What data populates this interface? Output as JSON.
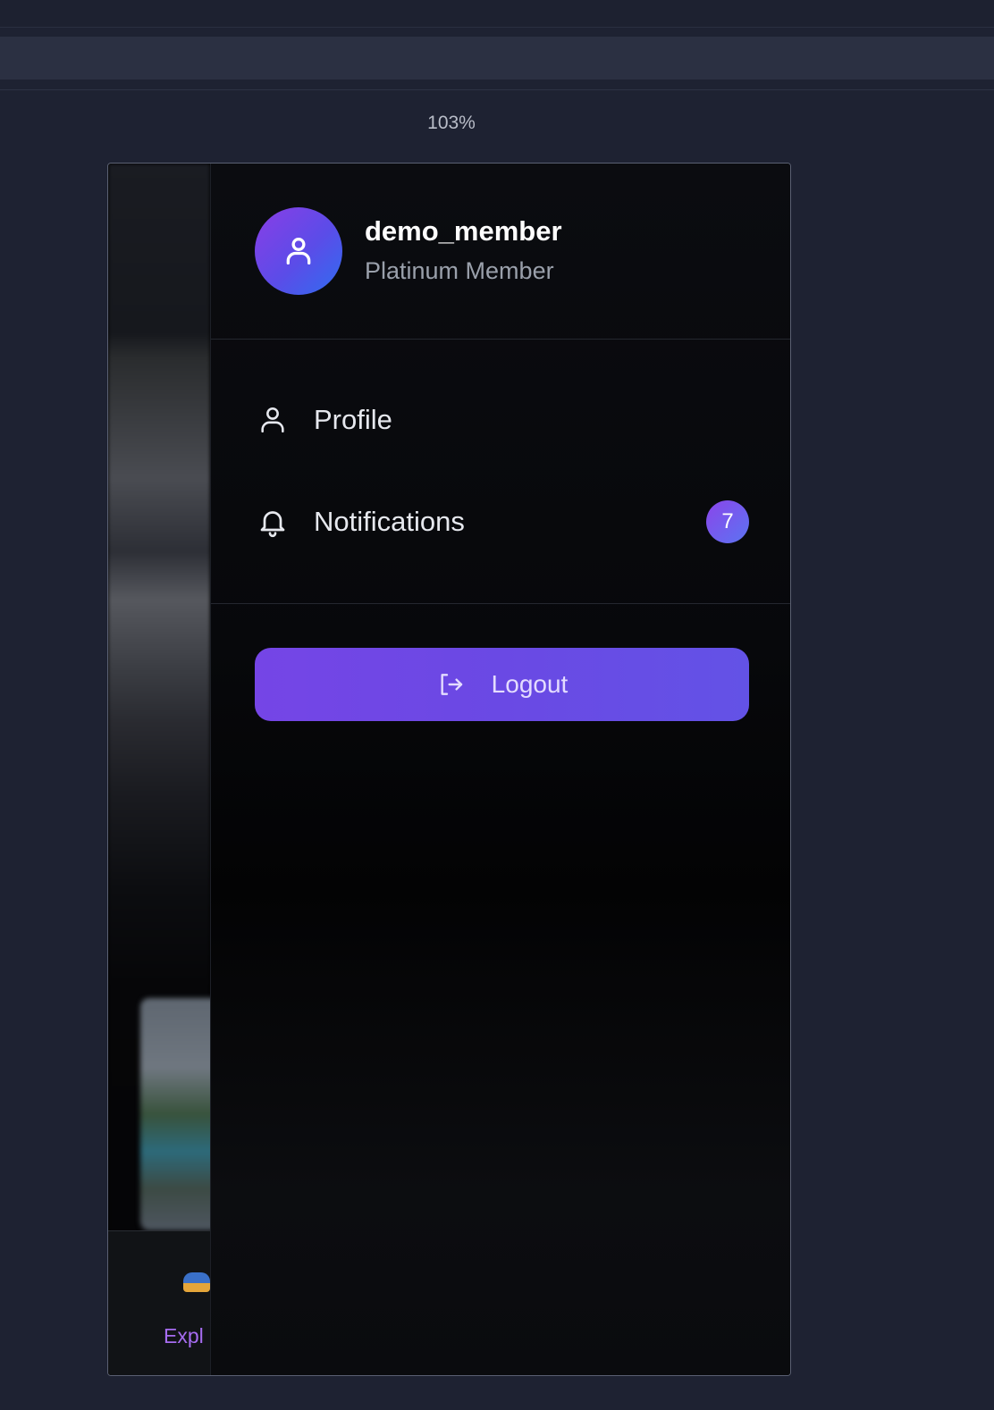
{
  "viewer": {
    "zoom": "103%"
  },
  "background_app": {
    "nav_label": "Expl"
  },
  "drawer": {
    "user": {
      "username": "demo_member",
      "membership": "Platinum Member",
      "avatar_icon": "user-icon"
    },
    "menu": [
      {
        "label": "Profile",
        "icon": "user-icon"
      },
      {
        "label": "Notifications",
        "icon": "bell-icon",
        "badge": "7"
      }
    ],
    "logout": {
      "label": "Logout",
      "icon": "logout-icon"
    }
  },
  "colors": {
    "accent": "#6d48e6",
    "background": "#1e2232",
    "drawer": "#07080b"
  }
}
